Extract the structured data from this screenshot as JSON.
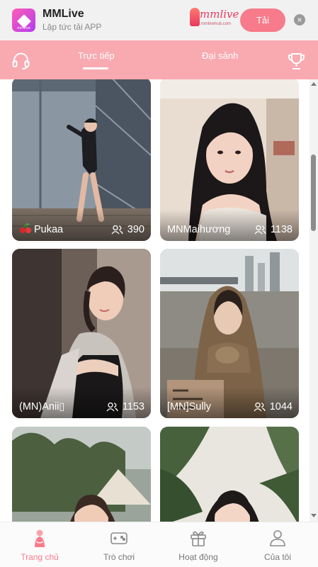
{
  "banner": {
    "app_name": "MMLive",
    "app_subtitle": "Lập tức tải APP",
    "logo_tag": "mmlive",
    "brand_word": "mmlive",
    "brand_small": "mmlivehub.com",
    "download_label": "Tải",
    "close_glyph": "×"
  },
  "topnav": {
    "tabs": [
      {
        "label": "Trực tiếp",
        "active": true
      },
      {
        "label": "Đại sảnh",
        "active": false
      }
    ],
    "left_icon": "headset-icon",
    "right_icon": "trophy-icon"
  },
  "streams": [
    {
      "name": "Pukaa",
      "viewers": "390",
      "badge": "cherry-icon"
    },
    {
      "name": "MNMaihương",
      "viewers": "1138"
    },
    {
      "name": "(MN)Anii▯",
      "viewers": "1153"
    },
    {
      "name": "[MN]Sully",
      "viewers": "1044"
    },
    {
      "name": "",
      "viewers": ""
    },
    {
      "name": "",
      "viewers": ""
    }
  ],
  "bottomnav": {
    "items": [
      {
        "label": "Trang chủ",
        "icon": "home-figure-icon",
        "active": true
      },
      {
        "label": "Trò chơi",
        "icon": "gamepad-icon",
        "active": false
      },
      {
        "label": "Hoạt động",
        "icon": "gift-box-icon",
        "active": false
      },
      {
        "label": "Của tôi",
        "icon": "profile-icon",
        "active": false
      }
    ]
  },
  "colors": {
    "accent": "#f77b8a",
    "nav_pink": "#f9a9b0",
    "banner_bg": "#f1f1f1"
  }
}
